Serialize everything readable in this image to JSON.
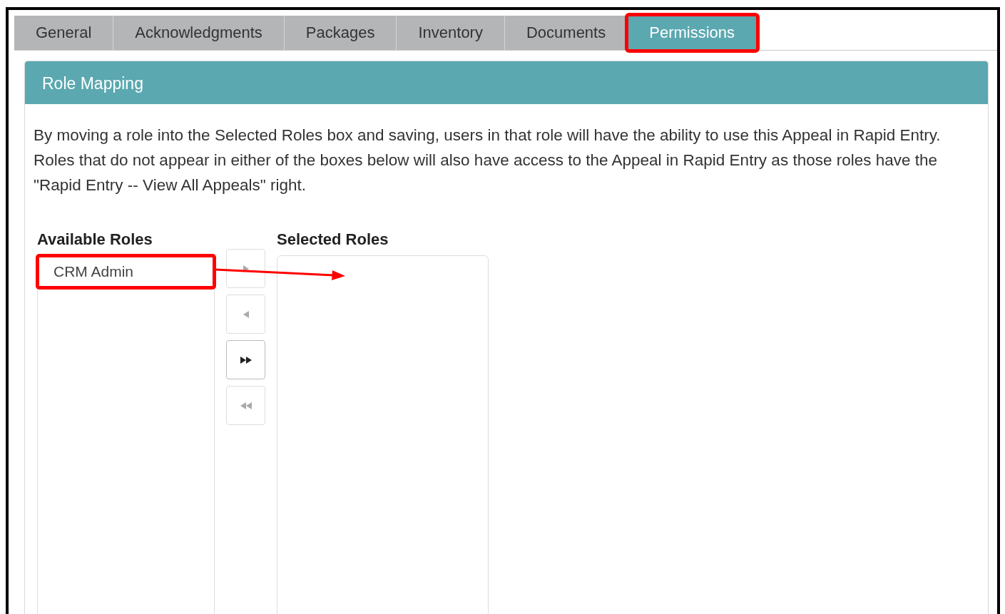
{
  "tabs": [
    {
      "label": "General",
      "selected": false,
      "highlighted": false
    },
    {
      "label": "Acknowledgments",
      "selected": false,
      "highlighted": false
    },
    {
      "label": "Packages",
      "selected": false,
      "highlighted": false
    },
    {
      "label": "Inventory",
      "selected": false,
      "highlighted": false
    },
    {
      "label": "Documents",
      "selected": false,
      "highlighted": false
    },
    {
      "label": "Permissions",
      "selected": true,
      "highlighted": true
    }
  ],
  "panel": {
    "title": "Role Mapping",
    "description": "By moving a role into the Selected Roles box and saving, users in that role will have the ability to use this Appeal in Rapid Entry. Roles that do not appear in either of the boxes below will also have access to the Appeal in Rapid Entry as those roles have the \"Rapid Entry -- View All Appeals\" right."
  },
  "available_roles": {
    "label": "Available Roles",
    "items": [
      {
        "label": "CRM Admin",
        "highlighted": true
      }
    ]
  },
  "move_buttons": [
    {
      "kind": "move-right",
      "disabled": true
    },
    {
      "kind": "move-left",
      "disabled": true
    },
    {
      "kind": "move-all-right",
      "disabled": false
    },
    {
      "kind": "move-all-left",
      "disabled": true
    }
  ],
  "selected_roles": {
    "label": "Selected Roles"
  },
  "annotation": {
    "kind": "arrow"
  }
}
